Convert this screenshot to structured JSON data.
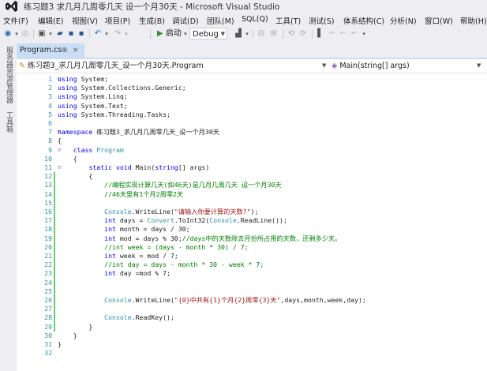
{
  "window": {
    "title": "练习题3 求几月几周零几天 设一个月30天 - Microsoft Visual Studio"
  },
  "menu": [
    "文件(F)",
    "编辑(E)",
    "视图(V)",
    "项目(P)",
    "生成(B)",
    "调试(D)",
    "团队(M)",
    "SQL(Q)",
    "工具(T)",
    "测试(S)",
    "体系结构(C)",
    "分析(N)",
    "窗口(W)",
    "帮助(H)"
  ],
  "toolbar": {
    "start_label": "启动",
    "config": "Debug"
  },
  "sidebar": {
    "tabs": [
      "服务器资源管理器",
      "工具箱"
    ]
  },
  "tab": {
    "label": "Program.cs",
    "pin": "⊕",
    "close": "×"
  },
  "nav": {
    "left": "练习题3_求几月几周零几天_设一个月30天.Program",
    "right": "Main(string[] args)"
  },
  "code_lines": [
    {
      "n": "1",
      "text": "using System;"
    },
    {
      "n": "2",
      "text": "using System.Collections.Generic;"
    },
    {
      "n": "3",
      "text": "using System.Linq;"
    },
    {
      "n": "4",
      "text": "using System.Text;"
    },
    {
      "n": "5",
      "text": "using System.Threading.Tasks;"
    },
    {
      "n": "6",
      "text": ""
    },
    {
      "n": "7",
      "text": "namespace 练习题3_求几月几周零几天_设一个月30天"
    },
    {
      "n": "8",
      "text": "{"
    },
    {
      "n": "9",
      "text": "    class Program"
    },
    {
      "n": "10",
      "text": "    {"
    },
    {
      "n": "11",
      "text": "        static void Main(string[] args)"
    },
    {
      "n": "12",
      "text": "        {"
    },
    {
      "n": "13",
      "text": "            //编程实现计算几天(如46天)是几月几周几天 设一个月30天"
    },
    {
      "n": "14",
      "text": "            //46天里有1个月2周零2天"
    },
    {
      "n": "15",
      "text": ""
    },
    {
      "n": "16",
      "text": "            Console.WriteLine(\"请输入你要计算的天数?\");"
    },
    {
      "n": "17",
      "text": "            int days = Convert.ToInt32(Console.ReadLine());"
    },
    {
      "n": "18",
      "text": "            int month = days / 30;"
    },
    {
      "n": "19",
      "text": "            int mod = days % 30;//days中的天数除去月份所占用的天数，还剩多少天。"
    },
    {
      "n": "20",
      "text": "            //int week = (days - month * 30) / 7;"
    },
    {
      "n": "21",
      "text": "            int week = mod / 7;"
    },
    {
      "n": "22",
      "text": "            //int day = days - month * 30 - week * 7;"
    },
    {
      "n": "23",
      "text": "            int day =mod % 7;"
    },
    {
      "n": "24",
      "text": ""
    },
    {
      "n": "25",
      "text": ""
    },
    {
      "n": "26",
      "text": "            Console.WriteLine(\"{0}中共有{1}个月{2}周零{3}天\",days,month,week,day);"
    },
    {
      "n": "27",
      "text": ""
    },
    {
      "n": "28",
      "text": "            Console.ReadKey();"
    },
    {
      "n": "29",
      "text": "        }"
    },
    {
      "n": "30",
      "text": "    }"
    },
    {
      "n": "31",
      "text": "}"
    },
    {
      "n": "32",
      "text": ""
    }
  ],
  "colors": {
    "keyword": "#0000ff",
    "type": "#2b91af",
    "string": "#a31515",
    "comment": "#008000",
    "change_bar": "#6ccc6c"
  }
}
